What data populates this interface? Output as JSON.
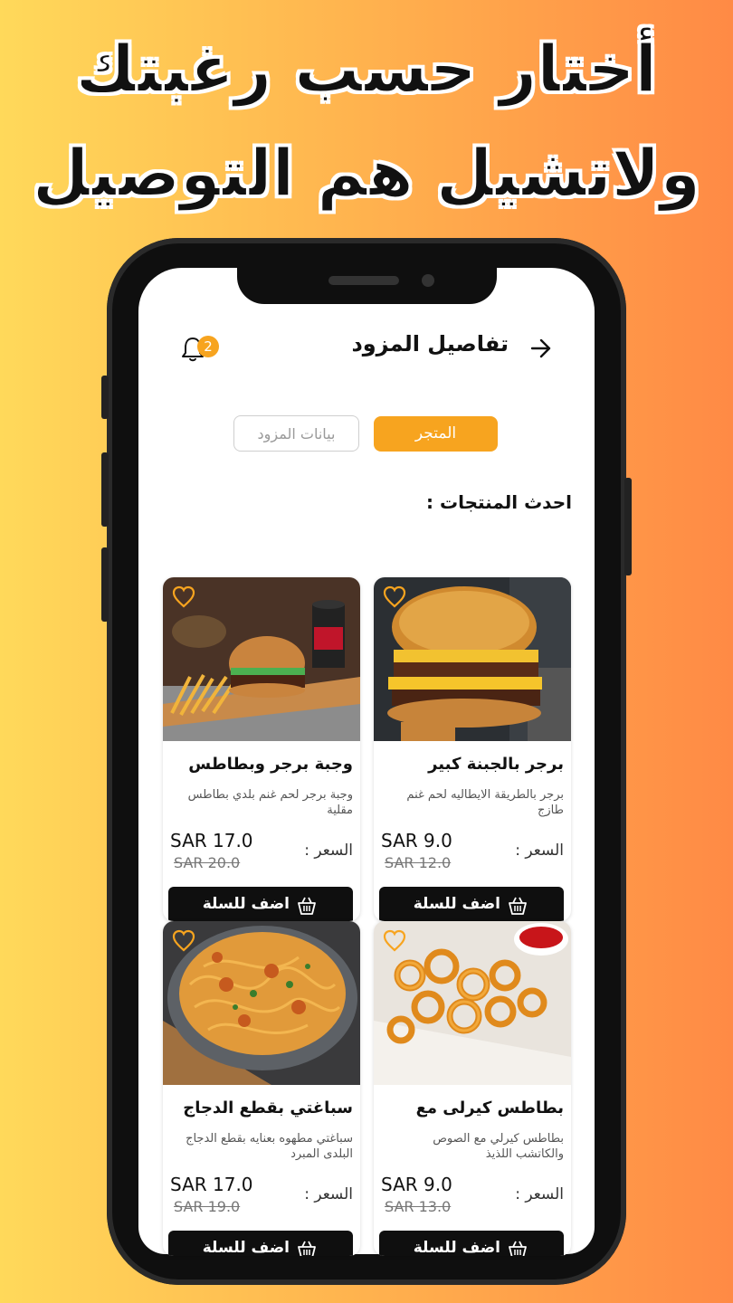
{
  "headline": {
    "line1": "أختار حسب رغبتك",
    "line2": "ولاتشيل هم التوصيل"
  },
  "header": {
    "title": "تفاصيل المزود",
    "notification_count": "2"
  },
  "tabs": {
    "store": "المتجر",
    "provider_info": "بيانات المزود"
  },
  "section_title": "احدث المنتجات :",
  "labels": {
    "price": "السعر :",
    "add_to_cart": "اضف للسلة"
  },
  "products": [
    {
      "title": "برجر بالجبنة كبير",
      "description": "برجر بالطريقة الايطاليه لحم غنم طازج",
      "price": "SAR 9.0",
      "old_price": "SAR 12.0"
    },
    {
      "title": "وجبة برجر وبطاطس",
      "description": "وجبة برجر لحم غنم بلدي بطاطس مقلية",
      "price": "SAR 17.0",
      "old_price": "SAR 20.0"
    },
    {
      "title": "بطاطس كيرلى مع",
      "description": "بطاطس كيرلي مع الصوص والكاتشب اللذيذ",
      "price": "SAR 9.0",
      "old_price": "SAR 13.0"
    },
    {
      "title": "سباغتي بقطع الدجاج",
      "description": "سباغتي مطهوه بعنايه بقطع الدجاج البلدى المبرد",
      "price": "SAR 17.0",
      "old_price": "SAR 19.0"
    }
  ],
  "colors": {
    "accent": "#F7A41F",
    "button": "#0f0f0f"
  }
}
